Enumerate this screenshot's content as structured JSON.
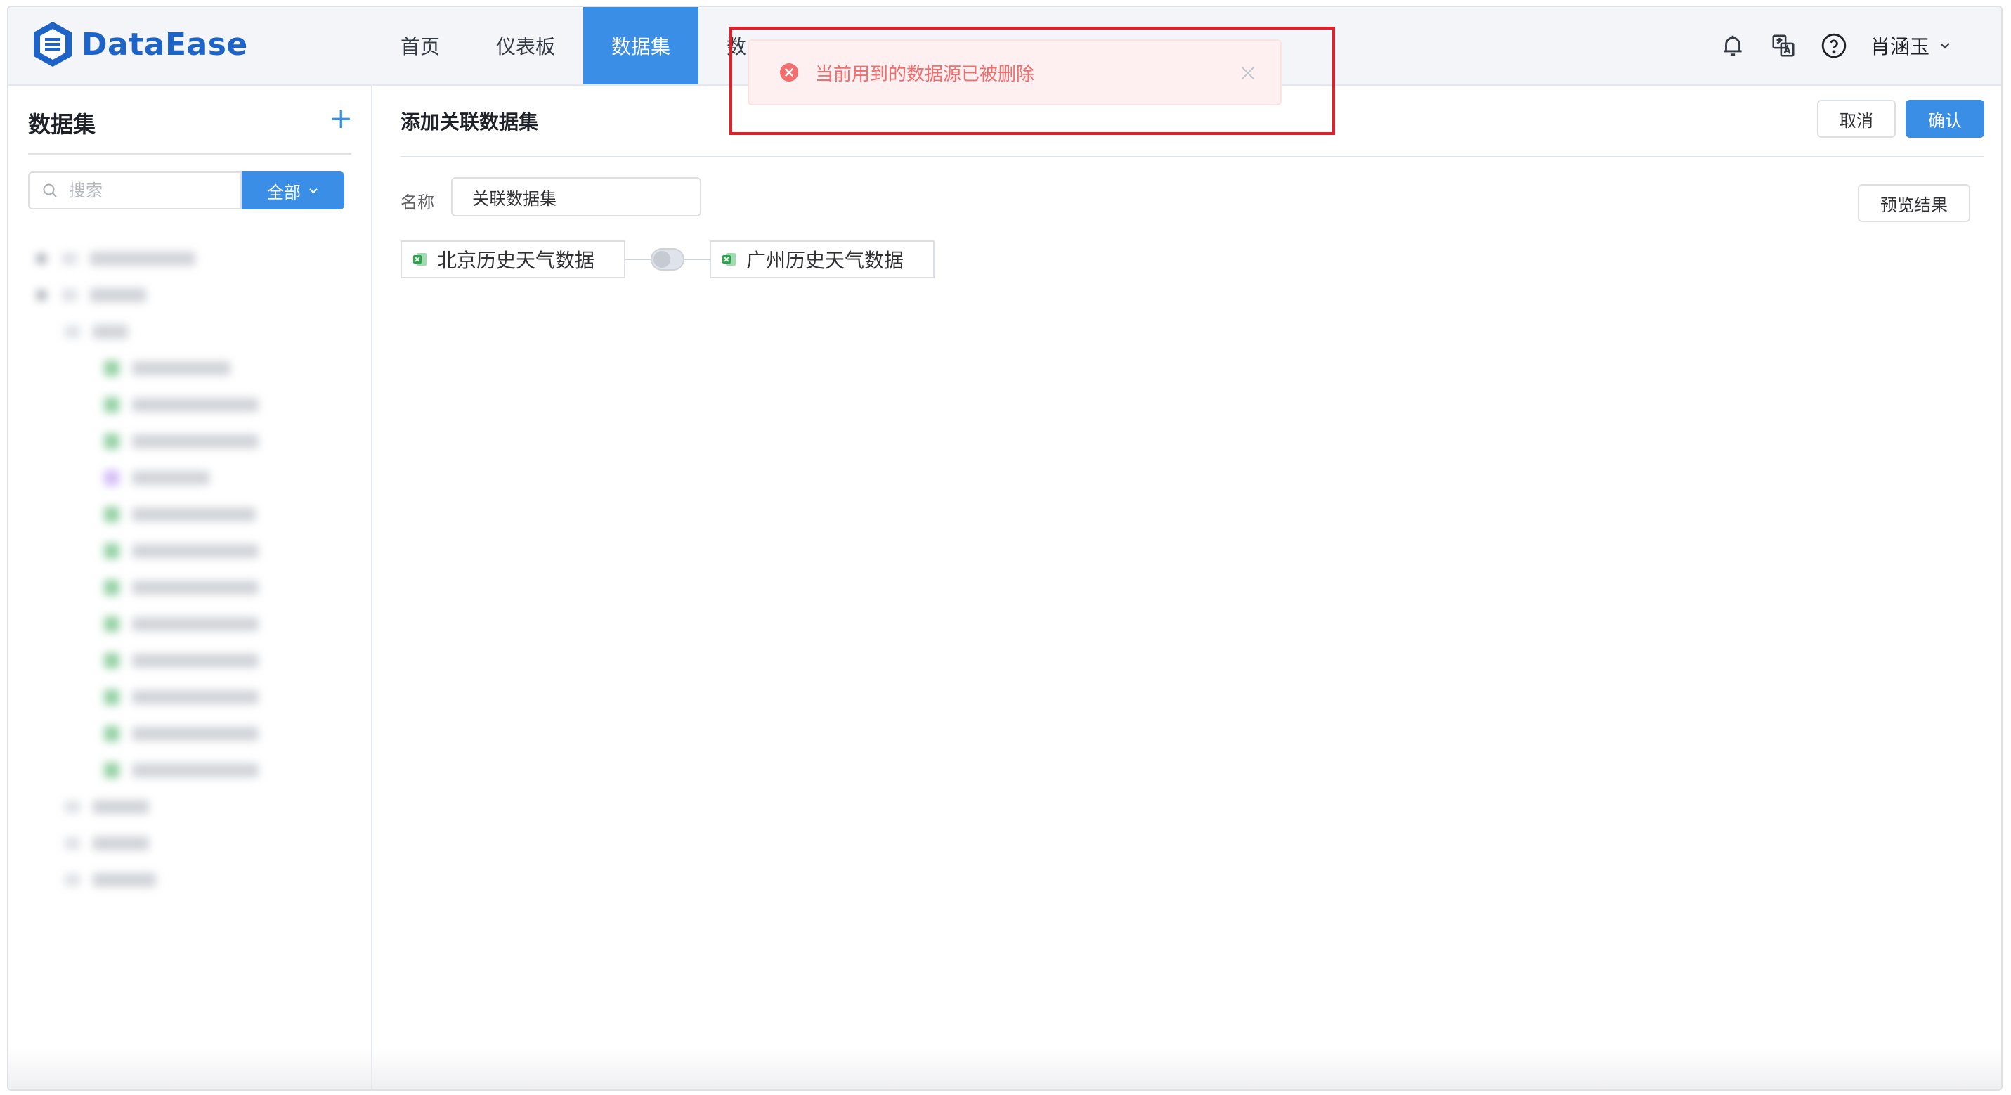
{
  "app": {
    "logo_text": "DataEase",
    "brand_color": "#1e63c8",
    "accent_color": "#3a8ee6"
  },
  "nav": {
    "items": [
      {
        "label": "首页"
      },
      {
        "label": "仪表板"
      },
      {
        "label": "数据集",
        "active": true
      },
      {
        "label": "数"
      }
    ]
  },
  "header": {
    "icons": [
      "notification-bell-icon",
      "translate-icon",
      "help-icon"
    ],
    "user_name": "肖涵玉"
  },
  "sidebar": {
    "title": "数据集",
    "add_icon": "plus-icon",
    "search_placeholder": "搜索",
    "filter_label": "全部"
  },
  "main": {
    "page_title": "添加关联数据集",
    "cancel_label": "取消",
    "confirm_label": "确认",
    "name_label": "名称",
    "name_value": "关联数据集",
    "preview_label": "预览结果",
    "left_dataset": "北京历史天气数据",
    "right_dataset": "广州历史天气数据"
  },
  "toast": {
    "type": "error",
    "message": "当前用到的数据源已被删除",
    "color": "#f56c6c"
  }
}
